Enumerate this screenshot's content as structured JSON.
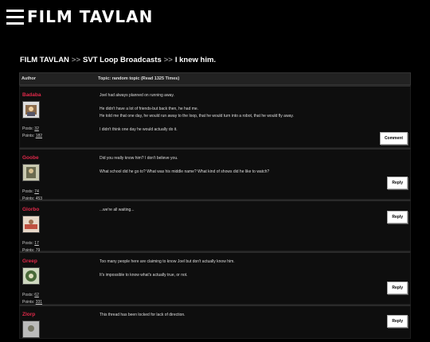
{
  "header": {
    "logo": "FILM TAVLAN"
  },
  "breadcrumb": {
    "home": "FILM TAVLAN",
    "board": "SVT Loop Broadcasts",
    "topic": "I knew him."
  },
  "table": {
    "author_header": "Author",
    "topic_header": "Topic: random topic  (Read 1325 Times)"
  },
  "labels": {
    "posts": "Posts:",
    "points": "Points:"
  },
  "posts": [
    {
      "user": "Badaba",
      "posts": "32",
      "points": "182",
      "lines": [
        "Joel had always planned on running away.",
        "He didn't have a lot of friends-but back then, he had me.",
        "He told me that one day, he would run away to the loop, that he would turn into a robot, that he would fly away.",
        "I didn't think one day he would actually do it."
      ],
      "button": "Comment"
    },
    {
      "user": "Goobe",
      "posts": "74",
      "points": "453",
      "lines": [
        "Did you really know him? I don't believe you.",
        "What school did he go to? What was his middle name? What kind of shows did he like to watch?"
      ],
      "button": "Reply"
    },
    {
      "user": "Glorbo",
      "posts": "17",
      "points": "79",
      "lines": [
        "...we're all waiting..."
      ],
      "button": "Reply"
    },
    {
      "user": "Greep",
      "posts": "62",
      "points": "331",
      "lines": [
        "Too many people here are claiming to know Joel but don't actually know him.",
        "It's impossible to know what's actually true, or not."
      ],
      "button": "Reply"
    },
    {
      "user": "Zlorp",
      "posts": "",
      "points": "",
      "lines": [
        "This thread has been locked for lack of direction."
      ],
      "button": "Reply"
    }
  ],
  "colors": {
    "username": "#e0294a",
    "background": "#000000",
    "post_bg": "#0e0e0e"
  },
  "icons": {
    "menu": "hamburger-menu-icon"
  }
}
